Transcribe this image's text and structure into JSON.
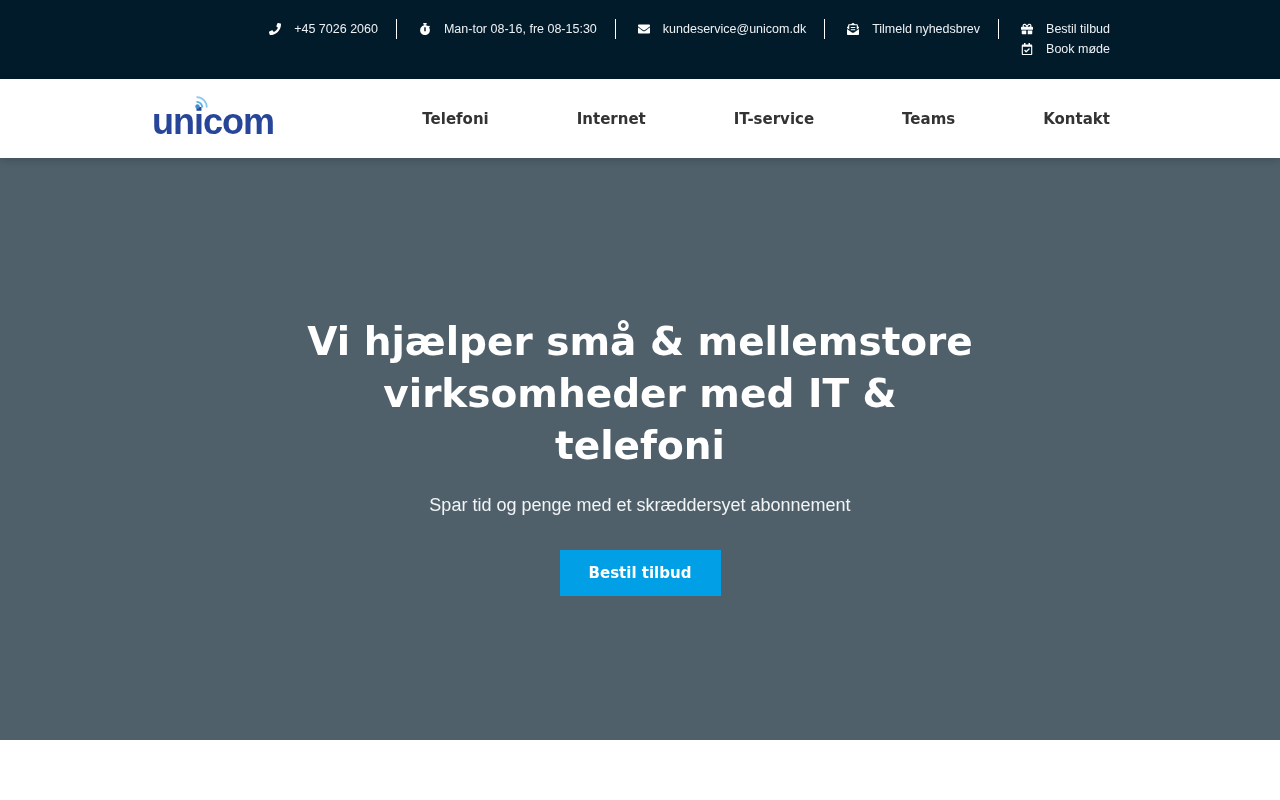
{
  "contact_bar": {
    "links": [
      {
        "label": "+45 7026 2060"
      },
      {
        "label": "Man-tor 08-16, fre 08-15:30"
      },
      {
        "label": "kundeservice@unicom.dk"
      },
      {
        "label": "Tilmeld nyhedsbrev"
      },
      {
        "label": "Bestil tilbud"
      },
      {
        "label": "Book møde"
      }
    ]
  },
  "header": {
    "logo": {
      "text": "unicom"
    },
    "nav": [
      {
        "label": "Telefoni"
      },
      {
        "label": "Internet"
      },
      {
        "label": "IT-service"
      },
      {
        "label": "Teams"
      },
      {
        "label": "Kontakt"
      }
    ]
  },
  "hero": {
    "title": "Vi hjælper små & mellemstore virksomheder med IT & telefoni",
    "subtitle": "Spar tid og penge med et skræddersyet abonnement",
    "button": "Bestil tilbud"
  }
}
